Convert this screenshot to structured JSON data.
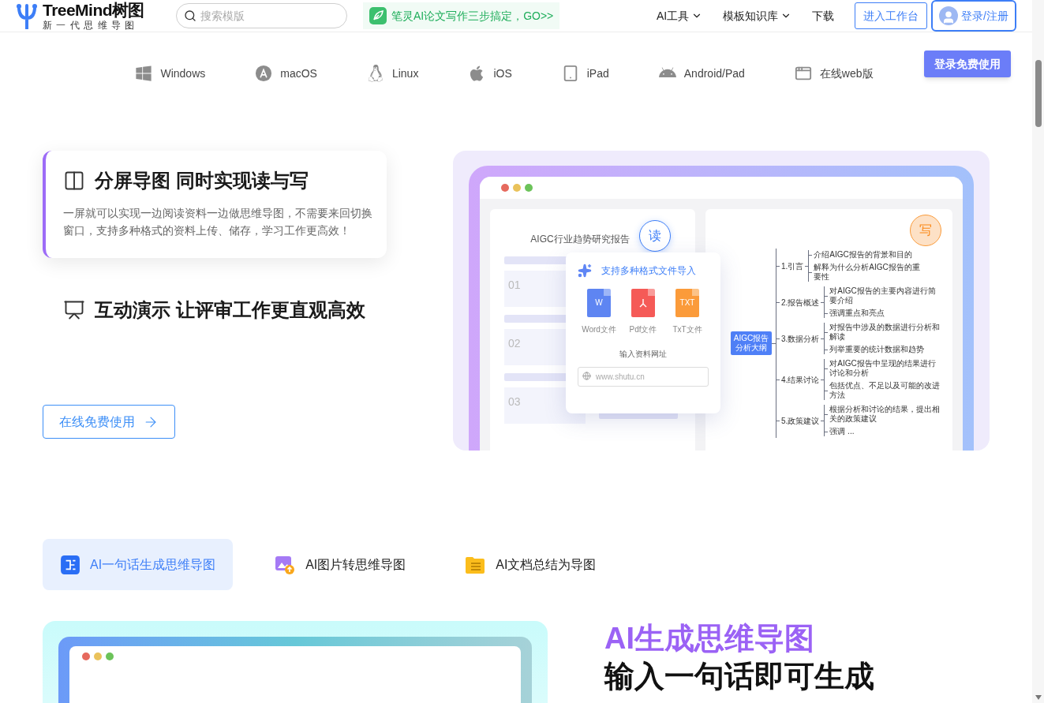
{
  "header": {
    "logo": {
      "name": "TreeMind树图",
      "tagline": "新一代思维导图"
    },
    "search": {
      "placeholder": "搜索模版"
    },
    "promo": "笔灵AI论文写作三步搞定，GO>>",
    "nav": [
      {
        "label": "AI工具",
        "dropdown": true
      },
      {
        "label": "模板知识库",
        "dropdown": true
      },
      {
        "label": "下载",
        "dropdown": false
      }
    ],
    "workspace_button": "进入工作台",
    "login_button": "登录/注册",
    "login_tooltip": "登录免费使用"
  },
  "platforms": [
    {
      "kind": "windows",
      "label": "Windows"
    },
    {
      "kind": "macos",
      "label": "macOS"
    },
    {
      "kind": "linux",
      "label": "Linux"
    },
    {
      "kind": "ios",
      "label": "iOS"
    },
    {
      "kind": "ipad",
      "label": "iPad"
    },
    {
      "kind": "android",
      "label": "Android/Pad"
    },
    {
      "kind": "web",
      "label": "在线web版"
    }
  ],
  "features": [
    {
      "kind": "split",
      "title": "分屏导图 同时实现读与写",
      "selected": true,
      "description": "一屏就可以实现一边阅读资料一边做思维导图，不需要来回切换窗口，支持多种格式的资料上传、储存，学习工作更高效！"
    },
    {
      "kind": "present",
      "title": "互动演示 让评审工作更直观高效",
      "selected": false
    }
  ],
  "cta": "在线免费使用",
  "demo": {
    "read_panel": {
      "title": "AIGC行业趋势研究报告",
      "badge": "读",
      "sections": [
        "01",
        "02",
        "03"
      ]
    },
    "import_popup": {
      "title": "支持多种格式文件导入",
      "files": [
        {
          "kind": "word",
          "mark": "W",
          "label": "Word文件"
        },
        {
          "kind": "pdf",
          "label": "Pdf文件"
        },
        {
          "kind": "txt",
          "mark": "TXT",
          "label": "TxT文件"
        }
      ],
      "url_label": "输入资料网址",
      "url_placeholder": "www.shutu.cn"
    },
    "write_panel": {
      "badge": "写",
      "mindmap": {
        "label": "AIGC报告分析大纲",
        "children": [
          {
            "label": "1.引言",
            "children": [
              {
                "label": "介绍AIGC报告的背景和目的"
              },
              {
                "label": "解释为什么分析AIGC报告的重要性"
              }
            ]
          },
          {
            "label": "2.报告概述",
            "children": [
              {
                "label": "对AIGC报告的主要内容进行简要介绍"
              },
              {
                "label": "强调重点和亮点"
              }
            ]
          },
          {
            "label": "3.数据分析",
            "children": [
              {
                "label": "对报告中涉及的数据进行分析和解读"
              },
              {
                "label": "列举重要的统计数据和趋势"
              }
            ]
          },
          {
            "label": "4.结果讨论",
            "children": [
              {
                "label": "对AIGC报告中呈现的结果进行讨论和分析"
              },
              {
                "label": "包括优点、不足以及可能的改进方法"
              }
            ]
          },
          {
            "label": "5.政策建议",
            "children": [
              {
                "label": "根据分析和讨论的结果，提出相关的政策建议"
              },
              {
                "label": "强调 ..."
              }
            ]
          }
        ]
      }
    }
  },
  "ai_tabs": [
    {
      "kind": "sentence",
      "label": "AI一句话生成思维导图",
      "selected": true
    },
    {
      "kind": "image",
      "label": "AI图片转思维导图",
      "selected": false
    },
    {
      "kind": "document",
      "label": "AI文档总结为导图",
      "selected": false
    }
  ],
  "ai_section": {
    "title": "AI生成思维导图",
    "subtitle": "输入一句话即可生成"
  }
}
